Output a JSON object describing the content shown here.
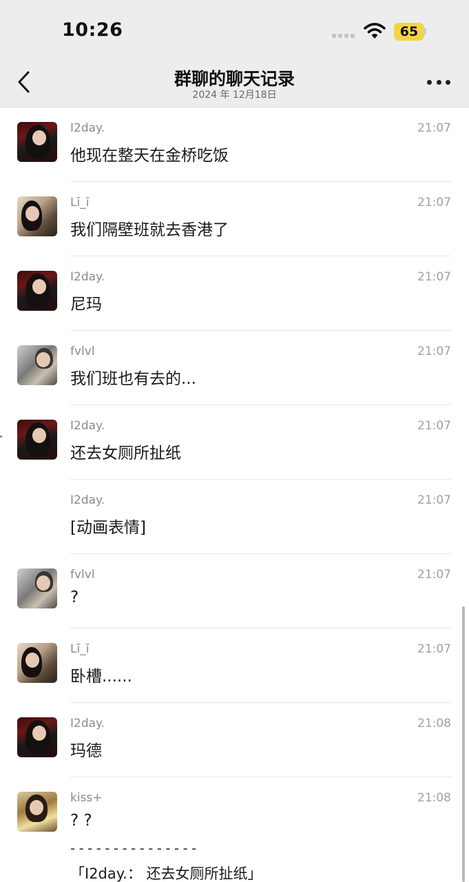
{
  "status_bar": {
    "time": "10:26",
    "battery": "65"
  },
  "header": {
    "title": "群聊的聊天记录",
    "date": "2024 年 12月18日"
  },
  "colors": {
    "battery": "#f3d34a",
    "header_bg": "#ededed",
    "sender": "#8a8a8a"
  },
  "messages": [
    {
      "sender": "I2day.",
      "time": "21:07",
      "text": "他现在整天在金桥吃饭",
      "avatar": "red-dark-portrait"
    },
    {
      "sender": "Lī_ī",
      "time": "21:07",
      "text": "我们隔壁班就去香港了",
      "avatar": "piano-girl"
    },
    {
      "sender": "I2day.",
      "time": "21:07",
      "text": "尼玛",
      "avatar": "red-dark-portrait"
    },
    {
      "sender": "fvlvl",
      "time": "21:07",
      "text": "我们班也有去的...",
      "avatar": "grey-portrait"
    },
    {
      "sender": "I2day.",
      "time": "21:07",
      "text": "还去女厕所扯纸",
      "avatar": "red-dark-portrait"
    },
    {
      "sender": "I2day.",
      "time": "21:07",
      "text": "[动画表情]",
      "avatar": ""
    },
    {
      "sender": "fvlvl",
      "time": "21:07",
      "text": "?",
      "avatar": "grey-portrait"
    },
    {
      "sender": "Lī_ī",
      "time": "21:07",
      "text": "卧槽......",
      "avatar": "piano-girl"
    },
    {
      "sender": "I2day.",
      "time": "21:08",
      "text": "玛德",
      "avatar": "red-dark-portrait"
    },
    {
      "sender": "kiss+",
      "time": "21:08",
      "text": "? ?",
      "avatar": "yellow-girl",
      "quote_divider": "- - - - - - - - - - - - - - -",
      "quote": "「I2day.： 还去女厕所扯纸」"
    }
  ]
}
